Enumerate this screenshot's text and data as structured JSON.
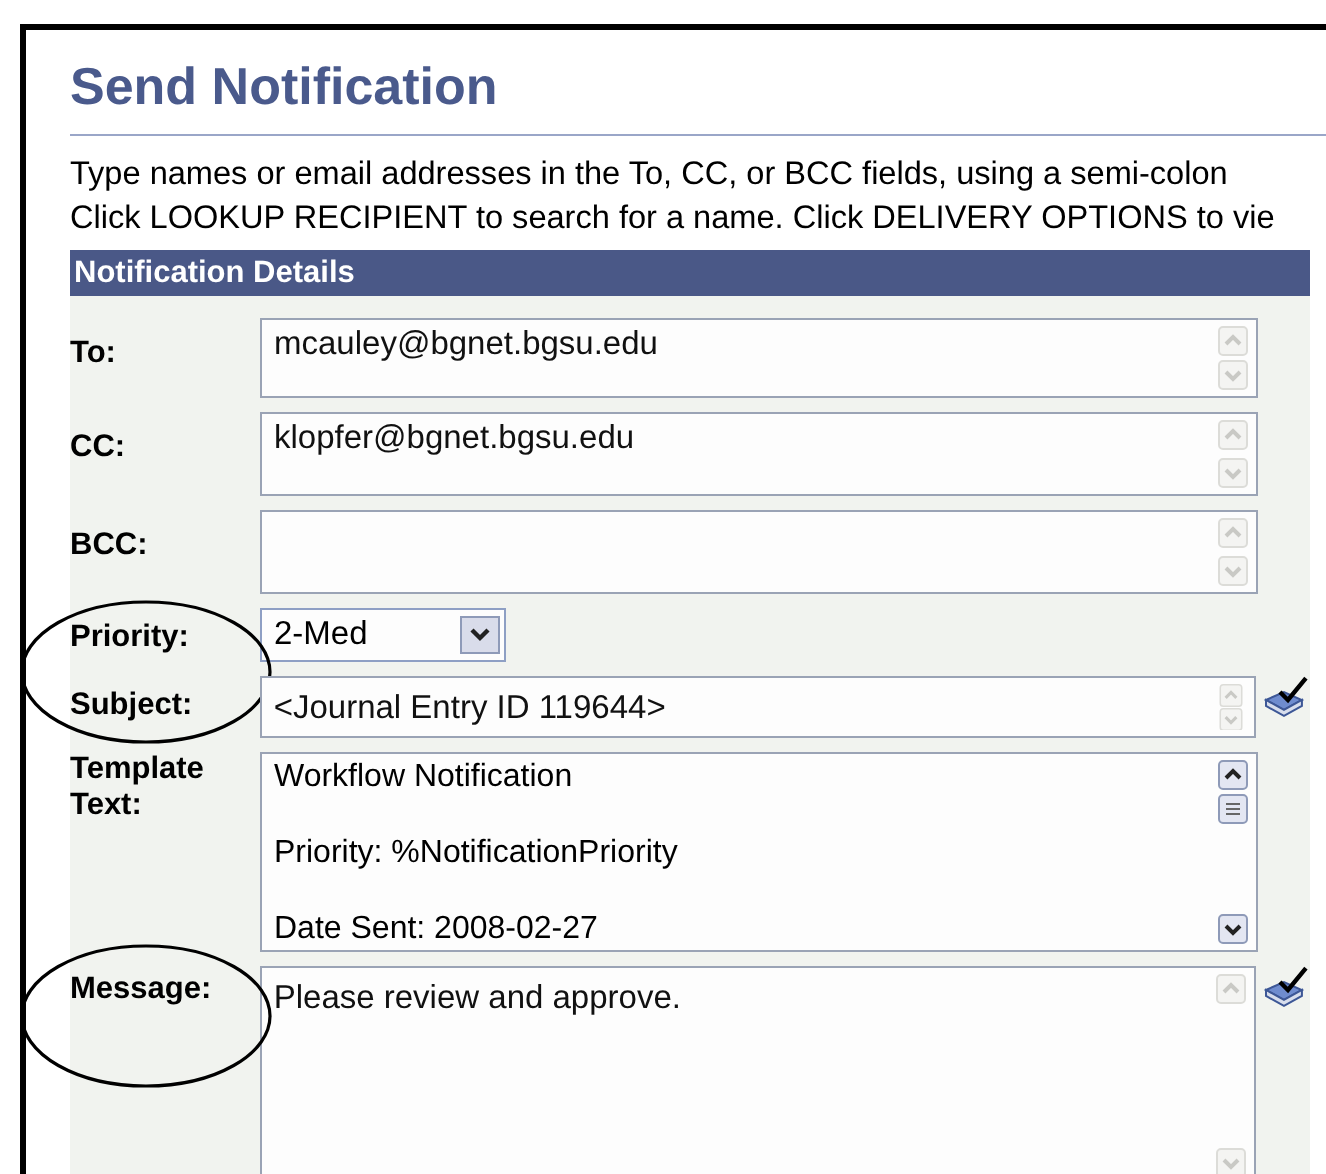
{
  "page": {
    "title": "Send Notification",
    "instructions": [
      "Type names or email addresses in the To, CC, or BCC fields, using a semi-colon",
      "Click LOOKUP RECIPIENT to search for a name.  Click DELIVERY OPTIONS to vie"
    ]
  },
  "section": {
    "title": "Notification Details"
  },
  "fields": [
    {
      "kind": "address",
      "label": "To:",
      "value": "mcauley@bgnet.bgsu.edu",
      "circled": false,
      "spellcheck": false
    },
    {
      "kind": "address",
      "label": "CC:",
      "value": "klopfer@bgnet.bgsu.edu",
      "circled": false,
      "spellcheck": false
    },
    {
      "kind": "address",
      "label": "BCC:",
      "circled": false,
      "spellcheck": false
    },
    {
      "kind": "select",
      "label": "Priority:",
      "value": "2-Med",
      "circled": true,
      "spellcheck": false
    },
    {
      "kind": "subject",
      "label": "Subject:",
      "value": "<Journal Entry ID 119644>",
      "circled": false,
      "spellcheck": true
    },
    {
      "kind": "template",
      "label": "Template Text:",
      "lines": [
        "Workflow Notification",
        "Priority:  %NotificationPriority",
        "Date Sent:  2008-02-27"
      ],
      "circled": false,
      "spellcheck": false
    },
    {
      "kind": "message",
      "label": "Message:",
      "value": "Please review and approve.",
      "circled": true,
      "spellcheck": true
    }
  ]
}
